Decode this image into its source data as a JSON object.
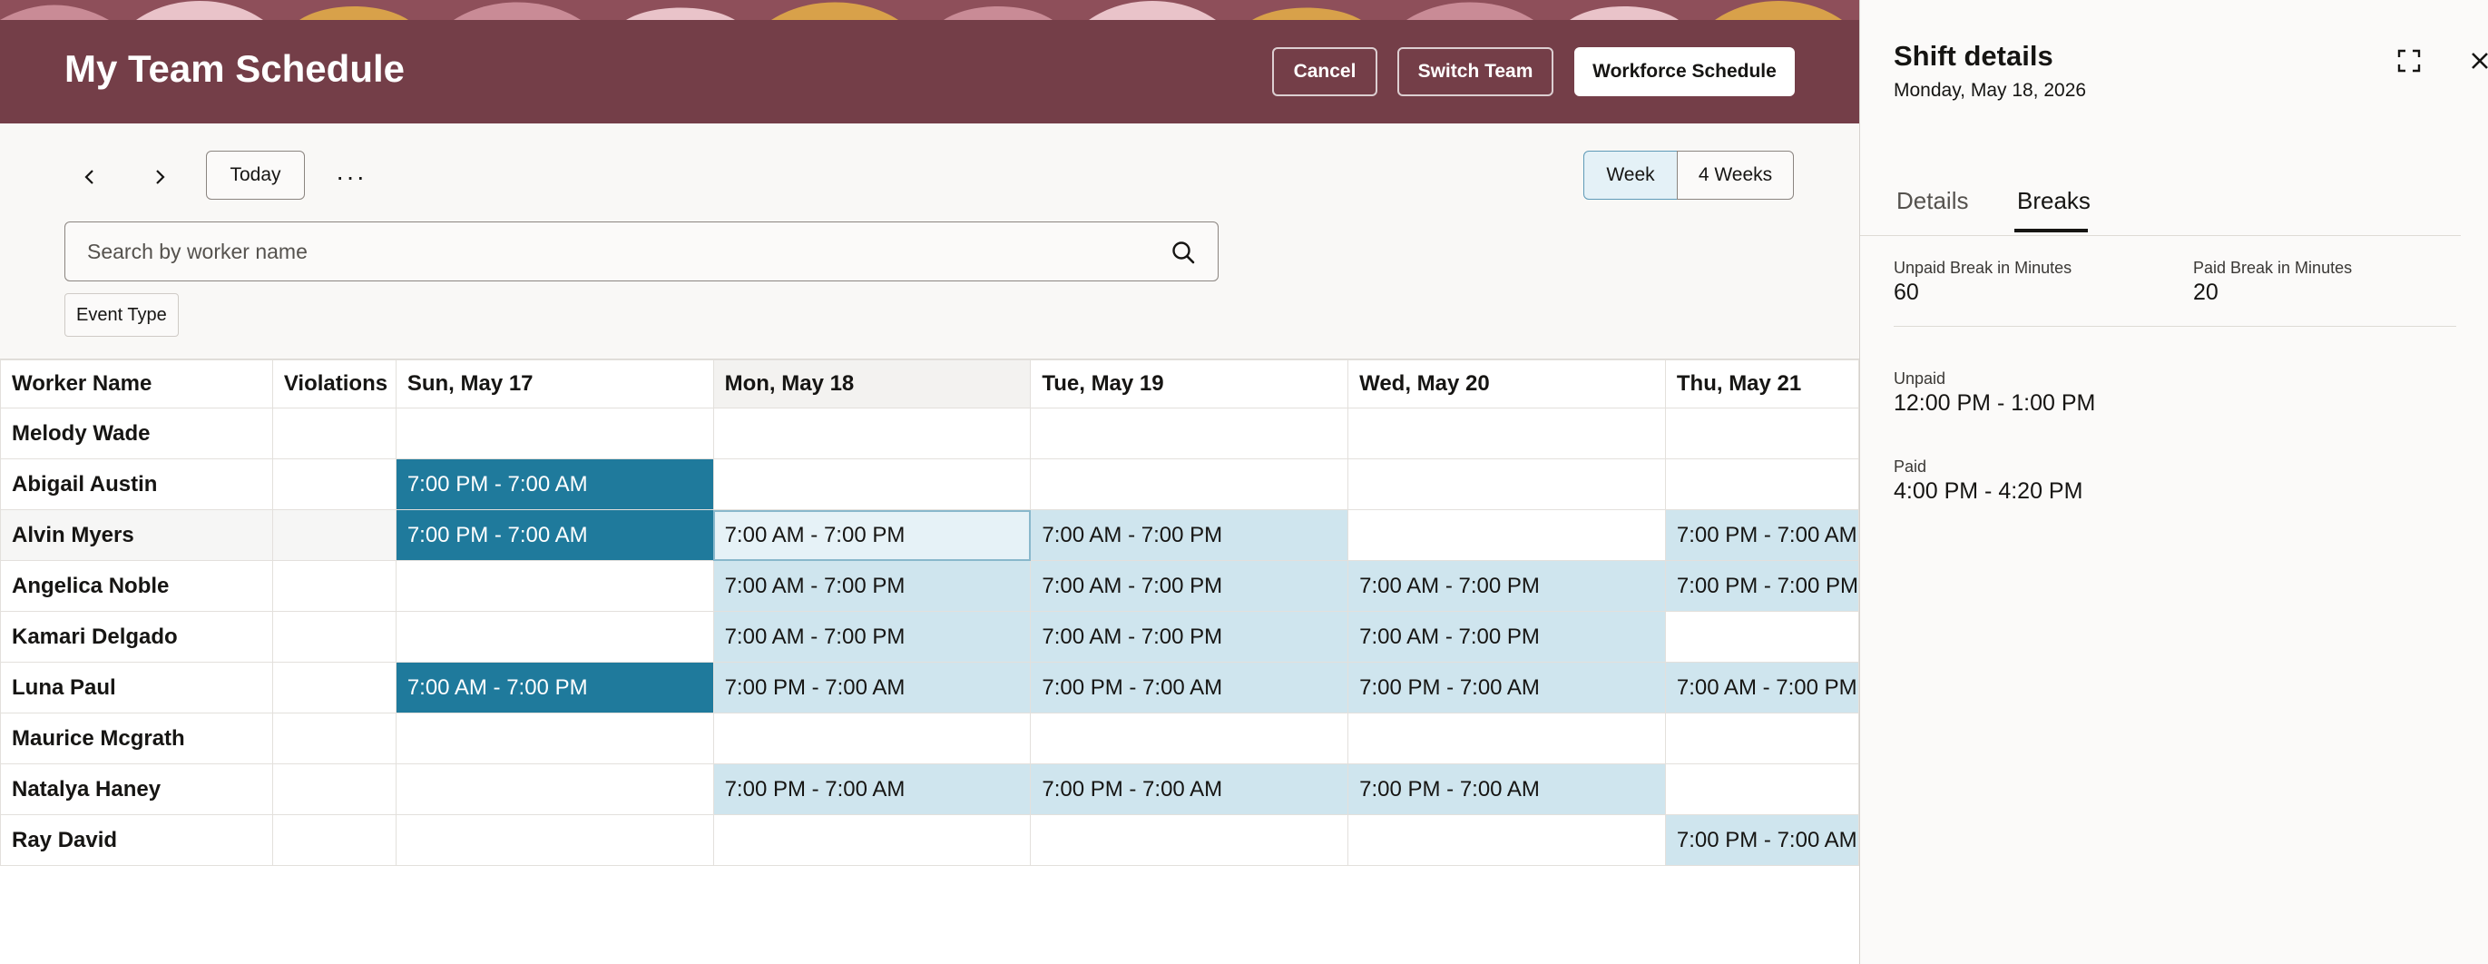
{
  "header": {
    "title": "My Team Schedule",
    "cancel_label": "Cancel",
    "switch_team_label": "Switch Team",
    "workforce_label": "Workforce Schedule"
  },
  "toolbar": {
    "today_label": "Today",
    "more_label": "···",
    "week_label": "Week",
    "four_weeks_label": "4 Weeks",
    "selected_view": "Week"
  },
  "search": {
    "placeholder": "Search by worker name",
    "value": ""
  },
  "filters": {
    "event_type_label": "Event Type"
  },
  "grid": {
    "columns": [
      "Worker Name",
      "Violations",
      "Sun, May 17",
      "Mon, May 18",
      "Tue, May 19",
      "Wed, May 20",
      "Thu, May 21"
    ],
    "rows": [
      {
        "name": "Melody Wade",
        "violations": "",
        "shifts": [
          {
            "text": "",
            "style": "none"
          },
          {
            "text": "",
            "style": "none"
          },
          {
            "text": "",
            "style": "none"
          },
          {
            "text": "",
            "style": "none"
          },
          {
            "text": "",
            "style": "none"
          }
        ]
      },
      {
        "name": "Abigail Austin",
        "violations": "",
        "shifts": [
          {
            "text": "7:00 PM - 7:00 AM",
            "style": "dark"
          },
          {
            "text": "",
            "style": "none"
          },
          {
            "text": "",
            "style": "none"
          },
          {
            "text": "",
            "style": "none"
          },
          {
            "text": "",
            "style": "none"
          }
        ]
      },
      {
        "name": "Alvin Myers",
        "violations": "",
        "shifts": [
          {
            "text": "7:00 PM - 7:00 AM",
            "style": "dark"
          },
          {
            "text": "7:00 AM - 7:00 PM",
            "style": "selected"
          },
          {
            "text": "7:00 AM - 7:00 PM",
            "style": "light"
          },
          {
            "text": "",
            "style": "none"
          },
          {
            "text": "7:00 PM - 7:00 AM",
            "style": "light"
          }
        ]
      },
      {
        "name": "Angelica Noble",
        "violations": "",
        "shifts": [
          {
            "text": "",
            "style": "none"
          },
          {
            "text": "7:00 AM - 7:00 PM",
            "style": "light"
          },
          {
            "text": "7:00 AM - 7:00 PM",
            "style": "light"
          },
          {
            "text": "7:00 AM - 7:00 PM",
            "style": "light"
          },
          {
            "text": "7:00 PM - 7:00 PM",
            "style": "light"
          }
        ]
      },
      {
        "name": "Kamari Delgado",
        "violations": "",
        "shifts": [
          {
            "text": "",
            "style": "none"
          },
          {
            "text": "7:00 AM - 7:00 PM",
            "style": "light"
          },
          {
            "text": "7:00 AM - 7:00 PM",
            "style": "light"
          },
          {
            "text": "7:00 AM - 7:00 PM",
            "style": "light"
          },
          {
            "text": "",
            "style": "none"
          }
        ]
      },
      {
        "name": "Luna Paul",
        "violations": "",
        "shifts": [
          {
            "text": "7:00 AM - 7:00 PM",
            "style": "dark"
          },
          {
            "text": "7:00 PM - 7:00 AM",
            "style": "light"
          },
          {
            "text": "7:00 PM - 7:00 AM",
            "style": "light"
          },
          {
            "text": "7:00 PM - 7:00 AM",
            "style": "light"
          },
          {
            "text": "7:00 AM - 7:00 PM",
            "style": "light"
          }
        ]
      },
      {
        "name": "Maurice Mcgrath",
        "violations": "",
        "shifts": [
          {
            "text": "",
            "style": "none"
          },
          {
            "text": "",
            "style": "none"
          },
          {
            "text": "",
            "style": "none"
          },
          {
            "text": "",
            "style": "none"
          },
          {
            "text": "",
            "style": "none"
          }
        ]
      },
      {
        "name": "Natalya Haney",
        "violations": "",
        "shifts": [
          {
            "text": "",
            "style": "none"
          },
          {
            "text": "7:00 PM - 7:00 AM",
            "style": "light"
          },
          {
            "text": "7:00 PM - 7:00 AM",
            "style": "light"
          },
          {
            "text": "7:00 PM - 7:00 AM",
            "style": "light"
          },
          {
            "text": "",
            "style": "none"
          }
        ]
      },
      {
        "name": "Ray David",
        "violations": "",
        "shifts": [
          {
            "text": "",
            "style": "none"
          },
          {
            "text": "",
            "style": "none"
          },
          {
            "text": "",
            "style": "none"
          },
          {
            "text": "",
            "style": "none"
          },
          {
            "text": "7:00 PM - 7:00 AM",
            "style": "light"
          }
        ]
      }
    ]
  },
  "panel": {
    "title": "Shift details",
    "date": "Monday, May 18, 2026",
    "tabs": [
      "Details",
      "Breaks"
    ],
    "active_tab": "Breaks",
    "unpaid_label": "Unpaid Break in Minutes",
    "unpaid_value": "60",
    "paid_label": "Paid Break in Minutes",
    "paid_value": "20",
    "breaks": [
      {
        "label": "Unpaid",
        "time": "12:00 PM - 1:00 PM"
      },
      {
        "label": "Paid",
        "time": "4:00 PM - 4:20 PM"
      }
    ]
  },
  "colors": {
    "header_bg": "#743e48",
    "shift_dark": "#1f7a9c",
    "shift_light": "#cfe5ee",
    "shift_selected": "#e6f2f7"
  },
  "icons": [
    "chevron-left-icon",
    "chevron-right-icon",
    "more-icon",
    "search-icon",
    "expand-icon",
    "close-icon"
  ]
}
